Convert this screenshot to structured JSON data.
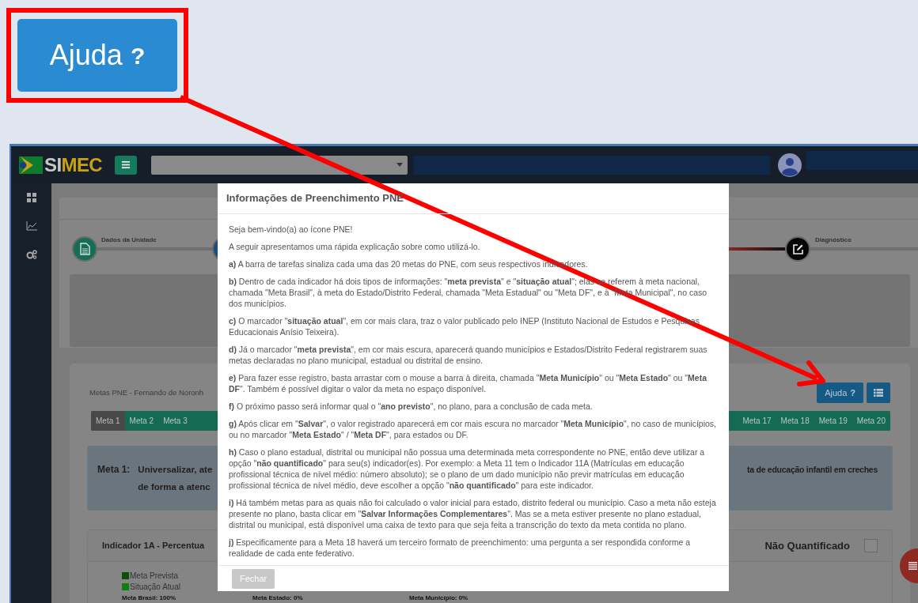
{
  "callout": {
    "button_label": "Ajuda",
    "button_glyph": "?"
  },
  "app": {
    "logo_left": "SI",
    "logo_right": "MEC"
  },
  "steps": [
    {
      "label": "Dados da Unidade"
    },
    {
      "label": "Diagnóstico"
    }
  ],
  "panel": {
    "title": "Metas PNE - Fernando de Noronh",
    "help_button": {
      "label": "Ajuda",
      "glyph": "?"
    }
  },
  "tabs_left": [
    {
      "label": "Meta 1",
      "selected": true
    },
    {
      "label": "Meta 2",
      "selected": false
    },
    {
      "label": "Meta 3",
      "selected": false
    }
  ],
  "tabs_right": [
    {
      "label": "Meta 17",
      "selected": false
    },
    {
      "label": "Meta 18",
      "selected": false
    },
    {
      "label": "Meta 19",
      "selected": false
    },
    {
      "label": "Meta 20",
      "selected": false
    }
  ],
  "meta": {
    "label": "Meta 1:",
    "text_left": [
      "Universalizar, ate",
      "de forma a atenc"
    ],
    "text_right": "ta de educação infantil em creches"
  },
  "indicator": {
    "title": "Indicador 1A - Percentua",
    "not_quantified_label": "Não Quantificado",
    "not_quantified_checked": false,
    "legend": [
      {
        "label": "Meta Prevista",
        "color": "#0b4f0b"
      },
      {
        "label": "Situação Atual",
        "color": "#0f800f"
      }
    ],
    "values": [
      "Meta Brasil: 100%",
      "Meta Estado: 0%",
      "Meta Município: 0%"
    ]
  },
  "modal": {
    "title": "Informações de Preenchimento PNE",
    "paragraphs": [
      "Seja bem-vindo(a) ao ícone PNE!",
      "A seguir apresentamos uma rápida explicação sobre como utilizá-lo.",
      "**a)** A barra de tarefas sinaliza cada uma das 20 metas do PNE, com seus respectivos indicadores.",
      "**b)** Dentro de cada indicador há dois tipos de informações: \"**meta prevista**\" e \"**situação atual**\"; elas se referem à meta nacional, chamada \"Meta Brasil\", à meta do Estado/Distrito Federal, chamada \"Meta Estadual\" ou \"Meta DF\", e à \"Meta Municipal\", no caso dos municípios.",
      "**c)** O marcador \"**situação atual**\", em cor mais clara, traz o valor publicado pelo INEP (Instituto Nacional de Estudos e Pesquisas Educacionais Anísio Teixeira).",
      "**d)** Já o marcador \"**meta prevista**\", em cor mais escura, aparecerá quando municípios e Estados/Distrito Federal registrarem suas metas declaradas no plano municipal, estadual ou distrital de ensino.",
      "**e)** Para fazer esse registro, basta arrastar com o mouse a barra à direita, chamada \"**Meta Município**\" ou \"**Meta Estado**\" ou \"**Meta DF**\". Também é possível digitar o valor da meta no espaço disponível.",
      "**f)** O próximo passo será informar qual o \"**ano previsto**\", no plano, para a conclusão de cada meta.",
      "**g)** Após clicar em \"**Salvar**\", o valor registrado aparecerá em cor mais escura no marcador \"**Meta Município**\", no caso de municípios, ou no marcador \"**Meta Estado**\" / \"**Meta DF**\", para estados ou DF.",
      "**h)** Caso o plano estadual, distrital ou municipal não possua uma determinada meta correspondente no PNE, então deve utilizar a opção \"**não quantificado**\" para seu(s) indicador(es). Por exemplo: a Meta 11 tem o Indicador 11A (Matrículas em educação profissional técnica de nível médio: número absoluto); se o plano de um dado município não previr matrículas em educação profissional técnica de nível médio, deve escolher a opção \"**não quantificado**\" para este indicador.",
      "**i)** Há também metas para as quais não foi calculado o valor inicial para estado, distrito federal ou município. Caso a meta não esteja presente no plano, basta clicar em \"**Salvar Informações Complementares**\". Mas se a meta estiver presente no plano estadual, distrital ou municipal, está disponível uma caixa de texto para que seja feita a transcrição do texto da meta contida no plano.",
      "**j)** Especificamente para a Meta 18 haverá um terceiro formato de preenchimento: uma pergunta a ser respondida conforme a realidade de cada ente federativo."
    ],
    "close_button": {
      "label": "Fechar",
      "disabled": true
    }
  }
}
